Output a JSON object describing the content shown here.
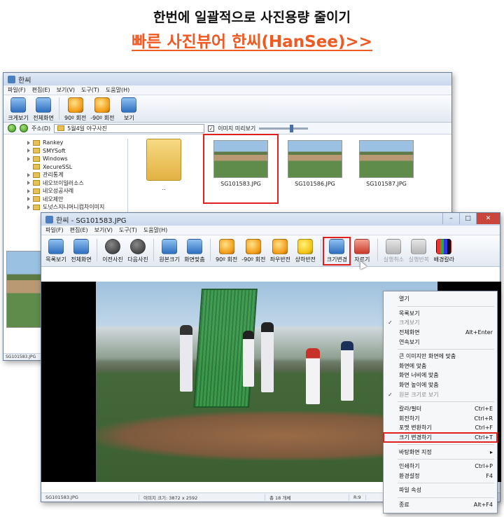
{
  "banner": {
    "line1": "한번에 일괄적으로 사진용량 줄이기",
    "line2": "빠른 사진뷰어 한씨(HanSee)>>"
  },
  "window_back": {
    "title": "한씨",
    "menu": [
      "파일(F)",
      "편집(E)",
      "보기(V)",
      "도구(T)",
      "도움말(H)"
    ],
    "toolbar": [
      {
        "label": "크게보기",
        "icon": "view-large-icon"
      },
      {
        "label": "전체화면",
        "icon": "fullscreen-icon"
      },
      {
        "label": "90º 회전",
        "icon": "rotate-cw-icon"
      },
      {
        "label": "-90º 회전",
        "icon": "rotate-ccw-icon"
      },
      {
        "label": "보기",
        "icon": "view-icon"
      }
    ],
    "address": {
      "label": "주소(D)",
      "value": "5월4일 야구사진"
    },
    "preview_checkbox": "이미지 미리보기",
    "tree": [
      "Rankey",
      "SMYSoft",
      "Windows",
      "XecureSSL",
      "관리통계",
      "네오브이일러소스",
      "네오성공사례",
      "네오제안",
      "도넛스지니머니컴차이미지"
    ],
    "thumbnails": [
      {
        "name": "..",
        "kind": "folder"
      },
      {
        "name": "SG101583.JPG",
        "selected": true
      },
      {
        "name": "SG101586.JPG"
      },
      {
        "name": "SG101587.JPG"
      }
    ],
    "status": "SG101583.JPG"
  },
  "window_front": {
    "title": "한씨 - SG101583.JPG",
    "menu": [
      "파일(F)",
      "편집(E)",
      "보기(V)",
      "도구(T)",
      "도움말(H)"
    ],
    "toolbar": [
      {
        "label": "목록보기",
        "icon": "list-view-icon"
      },
      {
        "label": "전체화면",
        "icon": "fullscreen-icon"
      },
      {
        "label": "이전사진",
        "icon": "previous-photo-icon"
      },
      {
        "label": "다음사진",
        "icon": "next-photo-icon"
      },
      {
        "label": "원본크기",
        "icon": "original-size-icon"
      },
      {
        "label": "화면맞춤",
        "icon": "fit-screen-icon"
      },
      {
        "label": "90º 회전",
        "icon": "rotate-cw-icon"
      },
      {
        "label": "-90º 회전",
        "icon": "rotate-ccw-icon"
      },
      {
        "label": "좌우반전",
        "icon": "flip-horizontal-icon"
      },
      {
        "label": "상하반전",
        "icon": "flip-vertical-icon"
      },
      {
        "label": "크기변경",
        "icon": "resize-icon"
      },
      {
        "label": "자르기",
        "icon": "crop-icon"
      },
      {
        "label": "실행취소",
        "icon": "undo-icon"
      },
      {
        "label": "실행반복",
        "icon": "redo-icon"
      },
      {
        "label": "배경칼라",
        "icon": "background-color-icon"
      }
    ],
    "status": {
      "file": "SG101583.JPG",
      "size": "이미지 크기: 3872 x 2592",
      "count": "총 18 개체",
      "zoom": "R:9"
    }
  },
  "context_menu": [
    {
      "label": "열기",
      "shortcut": ""
    },
    {
      "sep": true
    },
    {
      "label": "목록보기",
      "shortcut": ""
    },
    {
      "label": "크게보기",
      "shortcut": "",
      "checked": true,
      "dim": true
    },
    {
      "label": "전체화면",
      "shortcut": "Alt+Enter"
    },
    {
      "label": "연속보기",
      "shortcut": ""
    },
    {
      "sep": true
    },
    {
      "label": "큰 이미지만 화면에 맞춤",
      "shortcut": ""
    },
    {
      "label": "화면에 맞춤",
      "shortcut": ""
    },
    {
      "label": "화면 너비에 맞춤",
      "shortcut": ""
    },
    {
      "label": "화면 높이에 맞춤",
      "shortcut": ""
    },
    {
      "label": "원본 크기로 보기",
      "shortcut": "",
      "checked": true,
      "dim": true
    },
    {
      "sep": true
    },
    {
      "label": "칼라/필터",
      "shortcut": "Ctrl+E"
    },
    {
      "label": "회전하기",
      "shortcut": "Ctrl+R"
    },
    {
      "label": "포맷 변환하기",
      "shortcut": "Ctrl+F"
    },
    {
      "label": "크기 변경하기",
      "shortcut": "Ctrl+T",
      "highlight": true
    },
    {
      "sep": true
    },
    {
      "label": "바탕화면 지정",
      "shortcut": "",
      "submenu": true
    },
    {
      "sep": true
    },
    {
      "label": "인쇄하기",
      "shortcut": "Ctrl+P"
    },
    {
      "label": "환경설정",
      "shortcut": "F4"
    },
    {
      "sep": true
    },
    {
      "label": "파일 속성",
      "shortcut": ""
    },
    {
      "sep": true
    },
    {
      "label": "종료",
      "shortcut": "Alt+F4"
    }
  ],
  "colors": {
    "accent_link": "#ef5a24",
    "highlight_box": "#e0201f"
  }
}
